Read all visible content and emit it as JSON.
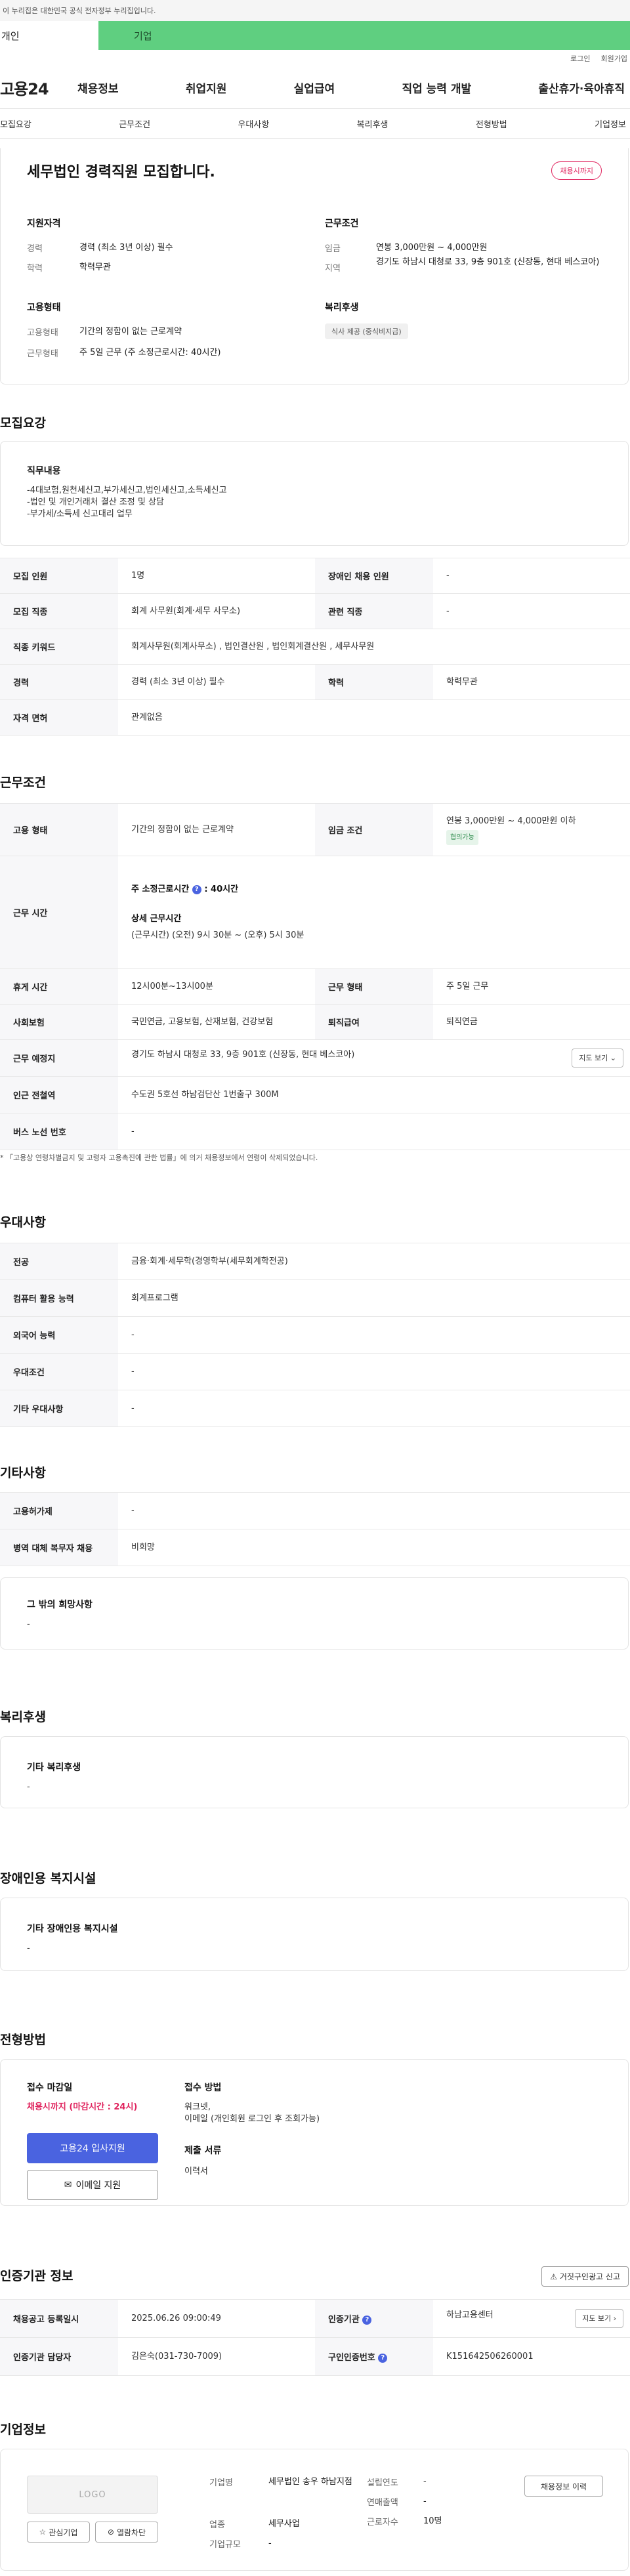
{
  "gov_banner": "이 누리집은 대한민국 공식 전자정부 누리집입니다.",
  "tabs": {
    "personal": "개인",
    "company": "기업"
  },
  "util": {
    "login": "로그인",
    "join": "회원가입"
  },
  "logo": "고용24",
  "gnb": [
    "채용정보",
    "취업지원",
    "실업급여",
    "직업 능력 개발",
    "출산휴가·육아휴직"
  ],
  "anchors": [
    "모집요강",
    "근무조건",
    "우대사항",
    "복리후생",
    "전형방법",
    "기업정보"
  ],
  "header": {
    "title": "세무법인 경력직원 모집합니다.",
    "status": "채용시까지",
    "qual_title": "지원자격",
    "career_label": "경력",
    "career_value": "경력 (최소 3년 이상) 필수",
    "edu_label": "학력",
    "edu_value": "학력무관",
    "cond_title": "근무조건",
    "wage_label": "임금",
    "wage_value": "연봉 3,000만원 ~ 4,000만원",
    "region_label": "지역",
    "region_value": "경기도 하남시 대청로 33, 9층 901호 (신장동, 현대 베스코아)",
    "emp_title": "고용형태",
    "emp_label": "고용형태",
    "emp_value": "기간의 정함이 없는 근로계약",
    "work_label": "근무형태",
    "work_value": "주 5일 근무 (주 소정근로시간: 40시간)",
    "welfare_title": "복리후생",
    "welfare_tag": "식사 제공 (중식비지급)"
  },
  "recruit": {
    "title": "모집요강",
    "duty_title": "직무내용",
    "duty_text": "-4대보험,원천세신고,부가세신고,법인세신고,소득세신고\n-법인 및 개인거래처 결산 조정 및 상담\n-부가세/소득세 신고대리 업무",
    "headcount_k": "모집 인원",
    "headcount_v": "1명",
    "disabled_k": "장애인 채용 인원",
    "disabled_v": "-",
    "job_k": "모집 직종",
    "job_v": "회계 사무원(회계·세무 사무소)",
    "related_k": "관련 직종",
    "related_v": "-",
    "kw_k": "직종 키워드",
    "kw_v": "회계사무원(회계사무소) , 법인결산원 , 법인회계결산원 , 세무사무원",
    "career_k": "경력",
    "career_v": "경력 (최소 3년 이상) 필수",
    "edu_k": "학력",
    "edu_v": "학력무관",
    "license_k": "자격 면허",
    "license_v": "관계없음"
  },
  "conditions": {
    "title": "근무조건",
    "emp_k": "고용 형태",
    "emp_v": "기간의 정함이 없는 근로계약",
    "wage_k": "임금 조건",
    "wage_v": "연봉 3,000만원 ~ 4,000만원 이하",
    "wage_chip": "협의가능",
    "hours_k": "근무 시간",
    "hours_main": "주 소정근로시간",
    "hours_main_v": ": 40시간",
    "hours_detail_title": "상세 근무시간",
    "hours_detail": "(근무시간) (오전) 9시 30분 ~ (오후) 5시 30분",
    "break_k": "휴게 시간",
    "break_v": "12시00분~13시00분",
    "worktype_k": "근무 형태",
    "worktype_v": "주 5일 근무",
    "insurance_k": "사회보험",
    "insurance_v": "국민연금, 고용보험, 산재보험, 건강보험",
    "retire_k": "퇴직급여",
    "retire_v": "퇴직연금",
    "place_k": "근무 예정지",
    "place_v": "경기도 하남시 대청로 33, 9층 901호 (신장동, 현대 베스코아)",
    "map_btn": "지도 보기",
    "subway_k": "인근 전철역",
    "subway_v": "수도권 5호선 하남검단산 1번출구 300M",
    "bus_k": "버스 노선 번호",
    "bus_v": "-",
    "note": "* 「고용상 연령차별금지 및 고령자 고용촉진에 관한 법률」에 의거 채용정보에서 연령이 삭제되었습니다."
  },
  "preference": {
    "title": "우대사항",
    "major_k": "전공",
    "major_v": "금융·회계·세무학(경영학부(세무회계학전공)",
    "pc_k": "컴퓨터 활용 능력",
    "pc_v": "회계프로그램",
    "lang_k": "외국어 능력",
    "lang_v": "-",
    "pref_k": "우대조건",
    "pref_v": "-",
    "etc_k": "기타 우대사항",
    "etc_v": "-"
  },
  "other": {
    "title": "기타사항",
    "permit_k": "고용허가제",
    "permit_v": "-",
    "military_k": "병역 대체 복무자 채용",
    "military_v": "비희망",
    "wish_title": "그 밖의 희망사항",
    "wish_v": "-"
  },
  "welfare": {
    "title": "복리후생",
    "box_title": "기타 복리후생",
    "box_v": "-"
  },
  "disabled": {
    "title": "장애인용 복지시설",
    "box_title": "기타 장애인용 복지시설",
    "box_v": "-"
  },
  "selection": {
    "title": "전형방법",
    "deadline_title": "접수 마감일",
    "deadline_v": "채용시까지 (마감시간 : 24시)",
    "apply_btn": "고용24 입사지원",
    "mail_btn": "이메일 지원",
    "method_title": "접수 방법",
    "method_v": "워크넷,\n이메일 (개인회원 로그인 후 조회가능)",
    "docs_title": "제출 서류",
    "docs_v": "이력서"
  },
  "certification": {
    "title": "인증기관 정보",
    "report_btn": "거짓구인광고 신고",
    "date_k": "채용공고 등록일시",
    "date_v": "2025.06.26 09:00:49",
    "org_k": "인증기관",
    "org_v": "하남고용센터",
    "map_btn": "지도 보기",
    "manager_k": "인증기관 담당자",
    "manager_v": "김은숙(031-730-7009)",
    "cert_k": "구인인증번호",
    "cert_v": "K151642506260001"
  },
  "company": {
    "title": "기업정보",
    "logo_text": "LOGO",
    "fav_btn": "관심기업",
    "block_btn": "열람차단",
    "name_k": "기업명",
    "name_v": "세무법인 송우 하남지점",
    "industry_k": "업종",
    "industry_v": "세무사업",
    "size_k": "기업규모",
    "size_v": "-",
    "founded_k": "설립연도",
    "founded_v": "-",
    "sales_k": "연매출액",
    "sales_v": "-",
    "emp_k": "근로자수",
    "emp_v": "10명",
    "history_btn": "채용정보 이력"
  }
}
